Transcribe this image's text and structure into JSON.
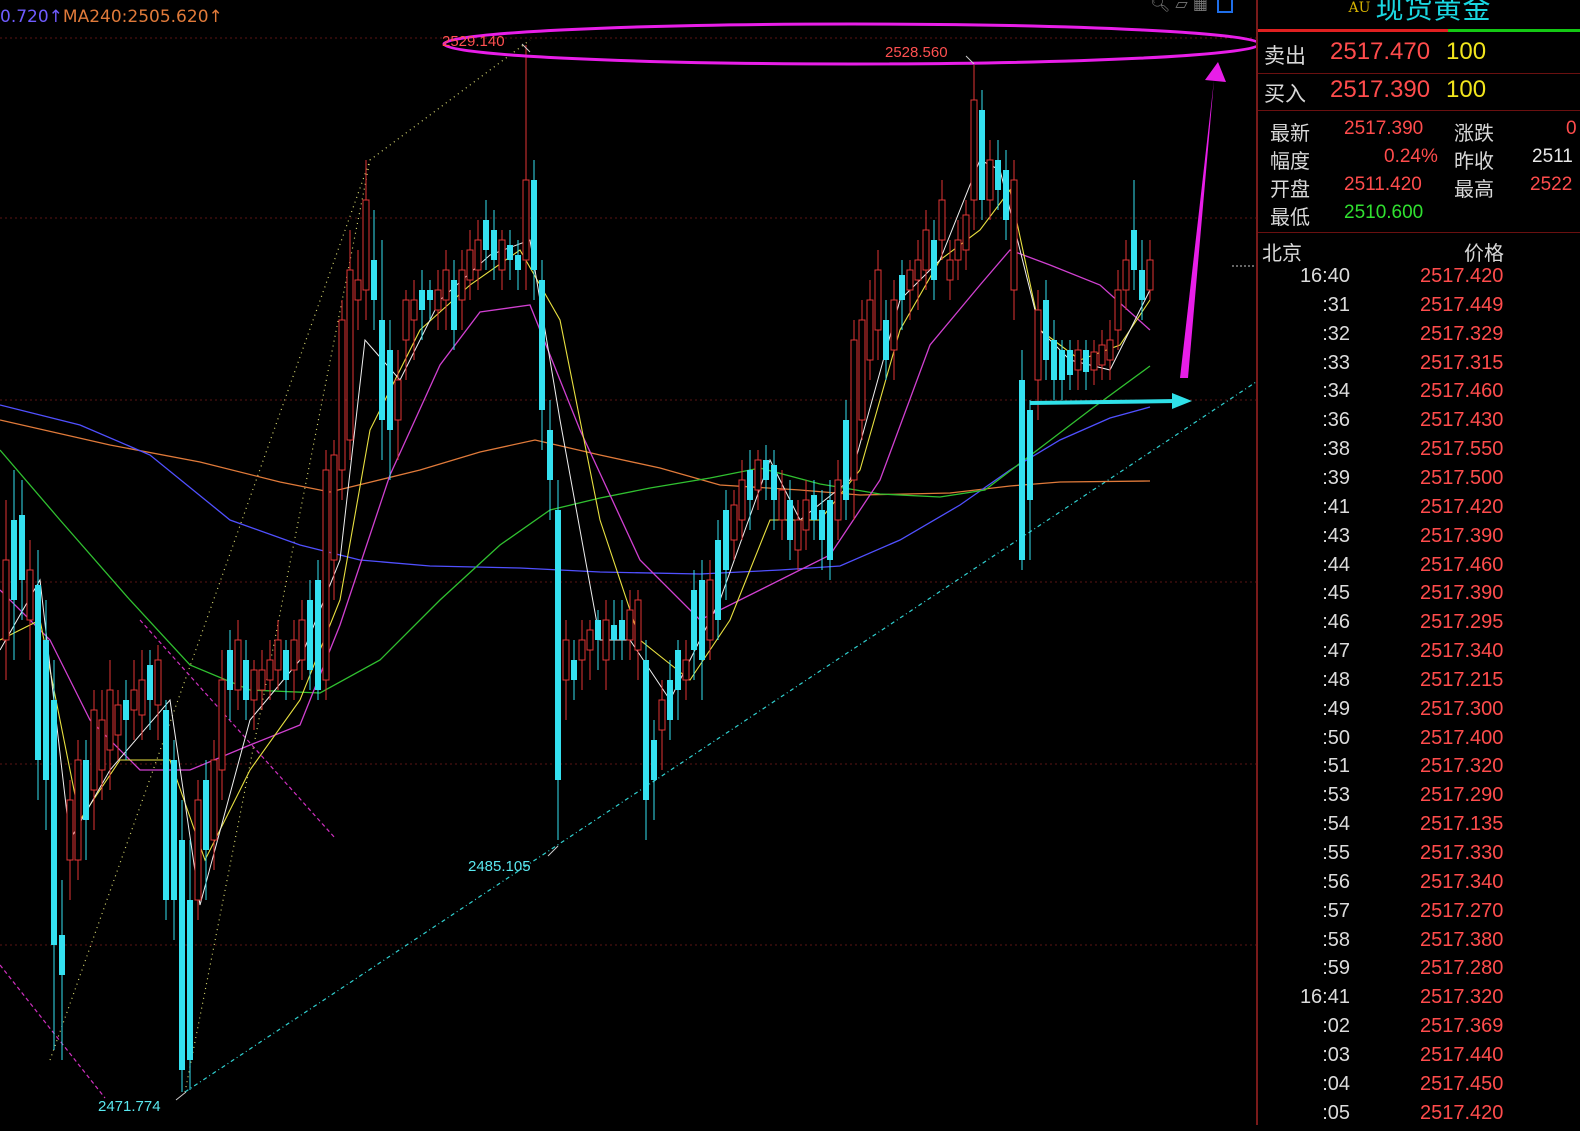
{
  "chart": {
    "ma_legend": {
      "ma_a": "0.720",
      "ma_b": "MA240:2505.620"
    },
    "price_labels": {
      "high_left": "2529.140",
      "high_right": "2528.560",
      "low_mid": "2485.105",
      "low_left": "2471.774"
    },
    "colors": {
      "up": "#e03535",
      "down": "#34e0f0",
      "ma5": "#f0f0f0",
      "ma10": "#e8e040",
      "ma20": "#d040d0",
      "ma60": "#30c030",
      "ma120": "#5050ff",
      "ma240": "#e07a3a",
      "annotation": "#e81ee8",
      "arrow_cyan": "#2fe0e8"
    }
  },
  "chart_data": {
    "type": "candlestick",
    "title": "",
    "ylim": [
      2469,
      2531
    ],
    "annotations": [
      "2529.140",
      "2528.560",
      "2485.105",
      "2471.774"
    ],
    "ohlc_summary": {
      "high": [
        2529.14,
        2528.56
      ],
      "low": [
        2485.105,
        2471.774
      ]
    }
  },
  "quote": {
    "code": "AU",
    "name": "现货黄金",
    "sell_label": "卖出",
    "sell_price": "2517.470",
    "sell_vol": "100",
    "buy_label": "买入",
    "buy_price": "2517.390",
    "buy_vol": "100",
    "stats": {
      "latest_k": "最新",
      "latest_v": "2517.390",
      "change_k": "涨跌",
      "change_v": "0",
      "range_k": "幅度",
      "range_v": "0.24%",
      "prev_k": "昨收",
      "prev_v": "2511",
      "open_k": "开盘",
      "open_v": "2511.420",
      "high_k": "最高",
      "high_v": "2522",
      "low_k": "最低",
      "low_v": "2510.600"
    },
    "ticks_header": {
      "time": "北京",
      "price": "价格"
    },
    "ticks": [
      {
        "t": "16:40",
        "p": "2517.420"
      },
      {
        "t": ":31",
        "p": "2517.449"
      },
      {
        "t": ":32",
        "p": "2517.329"
      },
      {
        "t": ":33",
        "p": "2517.315"
      },
      {
        "t": ":34",
        "p": "2517.460"
      },
      {
        "t": ":36",
        "p": "2517.430"
      },
      {
        "t": ":38",
        "p": "2517.550"
      },
      {
        "t": ":39",
        "p": "2517.500"
      },
      {
        "t": ":41",
        "p": "2517.420"
      },
      {
        "t": ":43",
        "p": "2517.390"
      },
      {
        "t": ":44",
        "p": "2517.460"
      },
      {
        "t": ":45",
        "p": "2517.390"
      },
      {
        "t": ":46",
        "p": "2517.295"
      },
      {
        "t": ":47",
        "p": "2517.340"
      },
      {
        "t": ":48",
        "p": "2517.215"
      },
      {
        "t": ":49",
        "p": "2517.300"
      },
      {
        "t": ":50",
        "p": "2517.400"
      },
      {
        "t": ":51",
        "p": "2517.320"
      },
      {
        "t": ":53",
        "p": "2517.290"
      },
      {
        "t": ":54",
        "p": "2517.135"
      },
      {
        "t": ":55",
        "p": "2517.330"
      },
      {
        "t": ":56",
        "p": "2517.340"
      },
      {
        "t": ":57",
        "p": "2517.270"
      },
      {
        "t": ":58",
        "p": "2517.380"
      },
      {
        "t": ":59",
        "p": "2517.280"
      },
      {
        "t": "16:41",
        "p": "2517.320"
      },
      {
        "t": ":02",
        "p": "2517.369"
      },
      {
        "t": ":03",
        "p": "2517.440"
      },
      {
        "t": ":04",
        "p": "2517.450"
      },
      {
        "t": ":05",
        "p": "2517.420"
      }
    ]
  }
}
